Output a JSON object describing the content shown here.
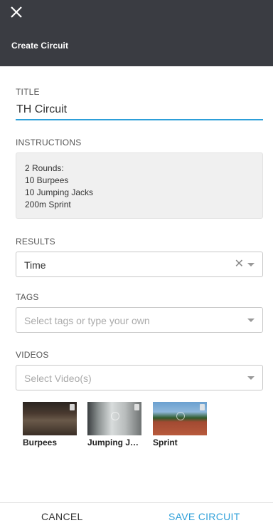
{
  "header": {
    "title": "Create Circuit",
    "close_icon": "close-icon"
  },
  "form": {
    "title_label": "TITLE",
    "title_value": "TH Circuit",
    "instructions_label": "INSTRUCTIONS",
    "instructions_lines": [
      "2 Rounds:",
      "10 Burpees",
      "10 Jumping Jacks",
      "200m Sprint"
    ],
    "results_label": "RESULTS",
    "results_value": "Time",
    "tags_label": "TAGS",
    "tags_placeholder": "Select tags or type your own",
    "videos_label": "VIDEOS",
    "videos_placeholder": "Select Video(s)"
  },
  "videos": [
    {
      "label": "Burpees"
    },
    {
      "label": "Jumping Jacks"
    },
    {
      "label": "Sprint"
    }
  ],
  "footer": {
    "cancel_label": "CANCEL",
    "save_label": "SAVE CIRCUIT"
  },
  "colors": {
    "header_bg": "#3a3c42",
    "accent": "#2d9fd9"
  }
}
